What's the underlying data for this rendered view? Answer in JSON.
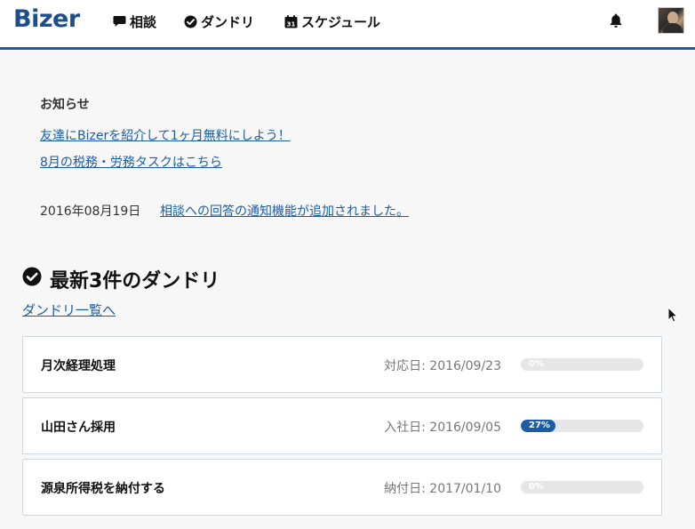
{
  "header": {
    "logo": "Bizer",
    "nav": [
      {
        "label": "相談",
        "icon": "speech-bubble-icon"
      },
      {
        "label": "ダンドリ",
        "icon": "check-circle-icon"
      },
      {
        "label": "スケジュール",
        "icon": "calendar-icon",
        "icon_text": "31"
      }
    ],
    "bell_icon": "bell-icon",
    "avatar": "user-avatar"
  },
  "news": {
    "heading": "お知らせ",
    "links": [
      "友達にBizerを紹介して1ヶ月無料にしよう！",
      "8月の税務・労務タスクはこちら"
    ],
    "update_date": "2016年08月19日",
    "update_link": "相談への回答の通知機能が追加されました。"
  },
  "dandori": {
    "title": "最新3件のダンドリ",
    "list_link": "ダンドリ一覧へ",
    "items": [
      {
        "title": "月次経理処理",
        "date": "対応日: 2016/09/23",
        "progress": 0,
        "progress_label": "0%"
      },
      {
        "title": "山田さん採用",
        "date": "入社日: 2016/09/05",
        "progress": 27,
        "progress_label": "27%"
      },
      {
        "title": "源泉所得税を納付する",
        "date": "納付日: 2017/01/10",
        "progress": 0,
        "progress_label": "0%"
      }
    ]
  },
  "colors": {
    "accent": "#1a5da6",
    "logo": "#1a4f8c",
    "track": "#e6e6e6"
  }
}
